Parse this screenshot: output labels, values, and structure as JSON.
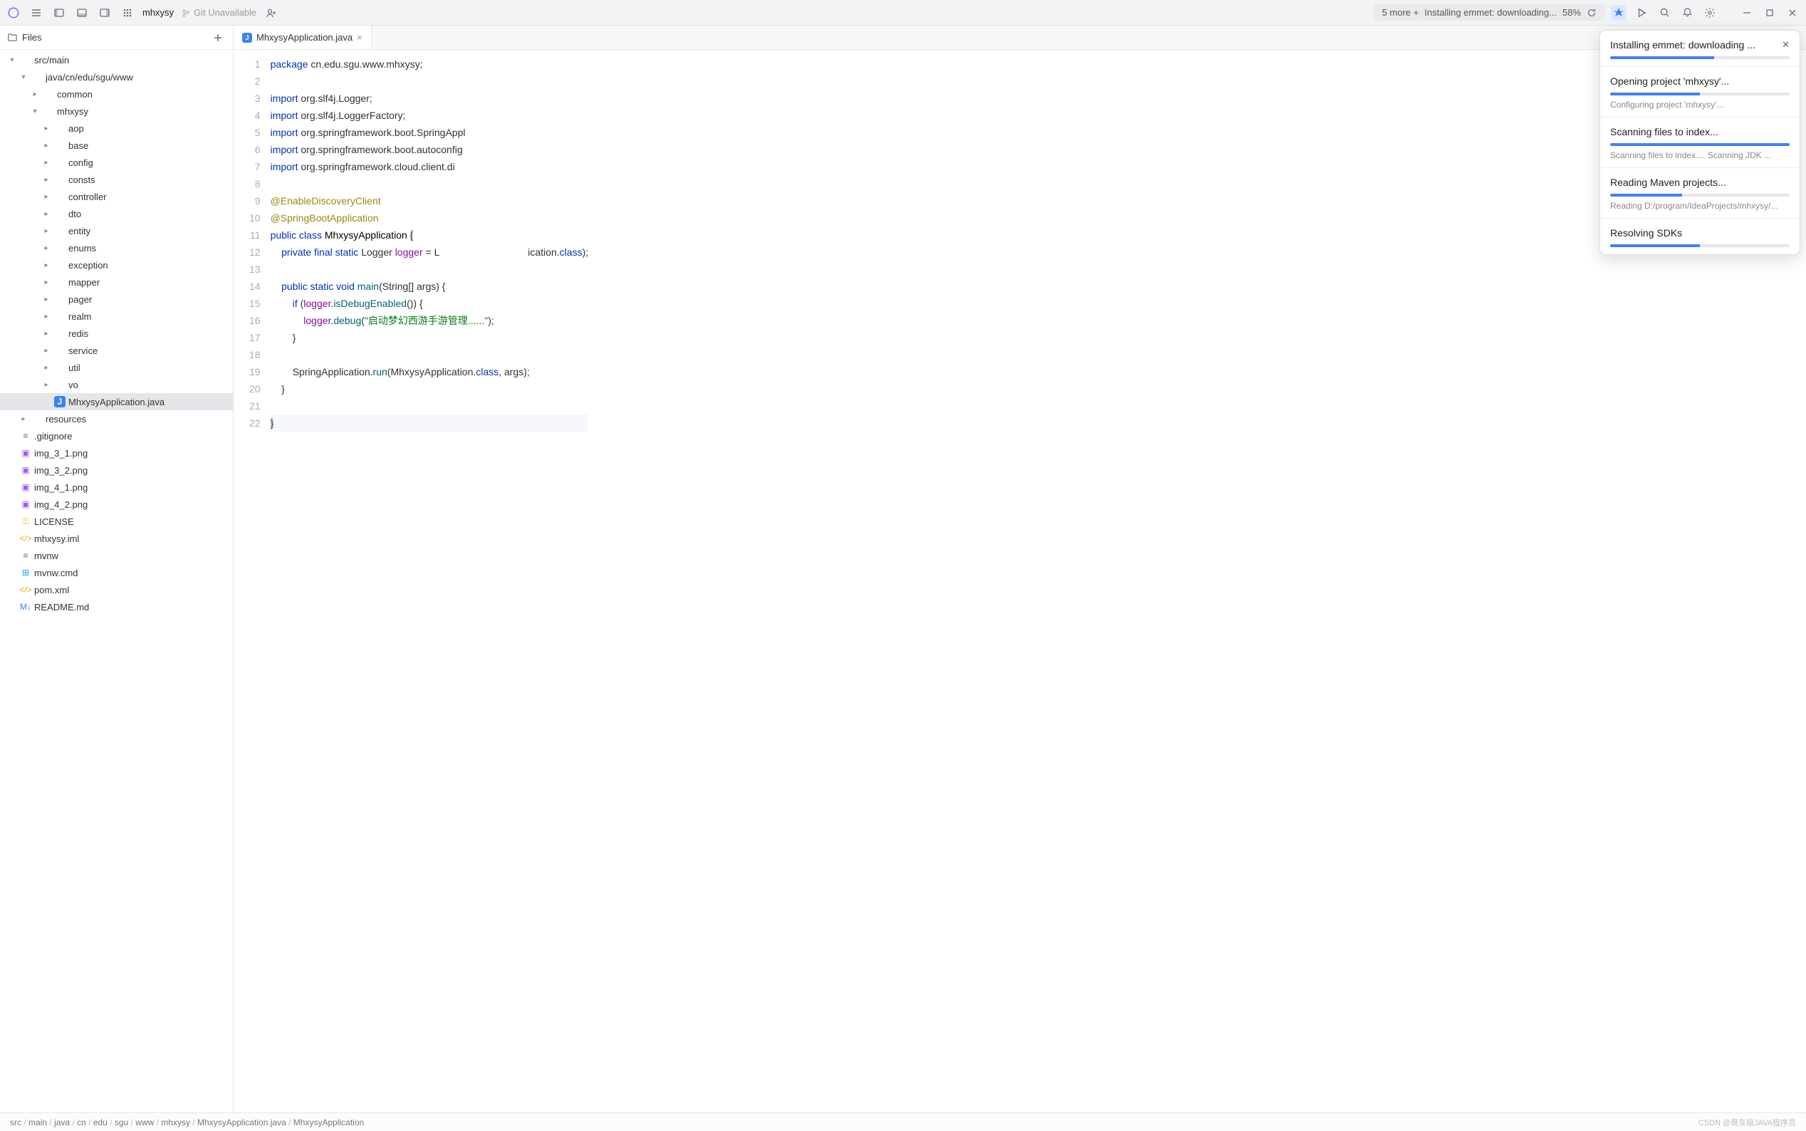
{
  "titlebar": {
    "project_name": "mhxysy",
    "git_status": "Git Unavailable",
    "bg_status_prefix": "5 more +",
    "bg_status_text": "Installing emmet: downloading...",
    "bg_status_pct": "58%"
  },
  "sidebar": {
    "title": "Files"
  },
  "tree": [
    {
      "depth": 0,
      "expand": "down",
      "icon": "folder",
      "label": "src/main"
    },
    {
      "depth": 1,
      "expand": "down",
      "icon": "folder",
      "label": "java/cn/edu/sgu/www"
    },
    {
      "depth": 2,
      "expand": "right",
      "icon": "folder",
      "label": "common"
    },
    {
      "depth": 2,
      "expand": "down",
      "icon": "folder",
      "label": "mhxysy"
    },
    {
      "depth": 3,
      "expand": "right",
      "icon": "folder",
      "label": "aop"
    },
    {
      "depth": 3,
      "expand": "right",
      "icon": "folder",
      "label": "base"
    },
    {
      "depth": 3,
      "expand": "right",
      "icon": "folder",
      "label": "config"
    },
    {
      "depth": 3,
      "expand": "right",
      "icon": "folder",
      "label": "consts"
    },
    {
      "depth": 3,
      "expand": "right",
      "icon": "folder",
      "label": "controller"
    },
    {
      "depth": 3,
      "expand": "right",
      "icon": "folder",
      "label": "dto"
    },
    {
      "depth": 3,
      "expand": "right",
      "icon": "folder",
      "label": "entity"
    },
    {
      "depth": 3,
      "expand": "right",
      "icon": "folder",
      "label": "enums"
    },
    {
      "depth": 3,
      "expand": "right",
      "icon": "folder",
      "label": "exception"
    },
    {
      "depth": 3,
      "expand": "right",
      "icon": "folder",
      "label": "mapper"
    },
    {
      "depth": 3,
      "expand": "right",
      "icon": "folder",
      "label": "pager"
    },
    {
      "depth": 3,
      "expand": "right",
      "icon": "folder",
      "label": "realm"
    },
    {
      "depth": 3,
      "expand": "right",
      "icon": "folder",
      "label": "redis"
    },
    {
      "depth": 3,
      "expand": "right",
      "icon": "folder",
      "label": "service"
    },
    {
      "depth": 3,
      "expand": "right",
      "icon": "folder",
      "label": "util"
    },
    {
      "depth": 3,
      "expand": "right",
      "icon": "folder",
      "label": "vo"
    },
    {
      "depth": 3,
      "expand": "none",
      "icon": "java",
      "label": "MhxysyApplication.java",
      "selected": true
    },
    {
      "depth": 1,
      "expand": "right",
      "icon": "folder",
      "label": "resources"
    },
    {
      "depth": 0,
      "expand": "none",
      "icon": "txt",
      "label": ".gitignore"
    },
    {
      "depth": 0,
      "expand": "none",
      "icon": "img",
      "label": "img_3_1.png"
    },
    {
      "depth": 0,
      "expand": "none",
      "icon": "img",
      "label": "img_3_2.png"
    },
    {
      "depth": 0,
      "expand": "none",
      "icon": "img",
      "label": "img_4_1.png"
    },
    {
      "depth": 0,
      "expand": "none",
      "icon": "img",
      "label": "img_4_2.png"
    },
    {
      "depth": 0,
      "expand": "none",
      "icon": "key",
      "label": "LICENSE"
    },
    {
      "depth": 0,
      "expand": "none",
      "icon": "xml",
      "label": "mhxysy.iml"
    },
    {
      "depth": 0,
      "expand": "none",
      "icon": "txt",
      "label": "mvnw"
    },
    {
      "depth": 0,
      "expand": "none",
      "icon": "win",
      "label": "mvnw.cmd"
    },
    {
      "depth": 0,
      "expand": "none",
      "icon": "xml",
      "label": "pom.xml"
    },
    {
      "depth": 0,
      "expand": "none",
      "icon": "md",
      "label": "README.md"
    }
  ],
  "tab": {
    "icon": "java",
    "label": "MhxysyApplication.java"
  },
  "code_lines": [
    {
      "n": 1,
      "t": [
        [
          "kw",
          "package"
        ],
        [
          "",
          " cn.edu.sgu.www.mhxysy;"
        ]
      ]
    },
    {
      "n": 2,
      "t": [
        [
          "",
          ""
        ]
      ]
    },
    {
      "n": 3,
      "t": [
        [
          "kw",
          "import"
        ],
        [
          "",
          " org.slf4j.Logger;"
        ]
      ]
    },
    {
      "n": 4,
      "t": [
        [
          "kw",
          "import"
        ],
        [
          "",
          " org.slf4j.LoggerFactory;"
        ]
      ]
    },
    {
      "n": 5,
      "t": [
        [
          "kw",
          "import"
        ],
        [
          "",
          " org.springframework.boot.SpringAppl"
        ]
      ]
    },
    {
      "n": 6,
      "t": [
        [
          "kw",
          "import"
        ],
        [
          "",
          " org.springframework.boot.autoconfig"
        ]
      ]
    },
    {
      "n": 7,
      "t": [
        [
          "kw",
          "import"
        ],
        [
          "",
          " org.springframework.cloud.client.di"
        ]
      ]
    },
    {
      "n": 8,
      "t": [
        [
          "",
          ""
        ]
      ]
    },
    {
      "n": 9,
      "t": [
        [
          "ann",
          "@EnableDiscoveryClient"
        ]
      ]
    },
    {
      "n": 10,
      "t": [
        [
          "ann",
          "@SpringBootApplication"
        ]
      ]
    },
    {
      "n": 11,
      "t": [
        [
          "kw",
          "public class"
        ],
        [
          "",
          " "
        ],
        [
          "cls",
          "MhxysyApplication"
        ],
        [
          "",
          " "
        ],
        [
          "hl-brace",
          "{"
        ]
      ]
    },
    {
      "n": 12,
      "t": [
        [
          "",
          "    "
        ],
        [
          "kw",
          "private final static"
        ],
        [
          "",
          " Logger "
        ],
        [
          "id",
          "logger"
        ],
        [
          "",
          " = L                                ication."
        ],
        [
          "kw",
          "class"
        ],
        [
          "",
          ");"
        ]
      ]
    },
    {
      "n": 13,
      "t": [
        [
          "",
          ""
        ]
      ]
    },
    {
      "n": 14,
      "t": [
        [
          "",
          "    "
        ],
        [
          "kw",
          "public static void"
        ],
        [
          "",
          " "
        ],
        [
          "mtd",
          "main"
        ],
        [
          "",
          "(String[] args) {"
        ]
      ]
    },
    {
      "n": 15,
      "t": [
        [
          "",
          "        "
        ],
        [
          "kw",
          "if"
        ],
        [
          "",
          " ("
        ],
        [
          "id",
          "logger"
        ],
        [
          "",
          "."
        ],
        [
          "mtd",
          "isDebugEnabled"
        ],
        [
          "",
          "()) {"
        ]
      ]
    },
    {
      "n": 16,
      "t": [
        [
          "",
          "            "
        ],
        [
          "id",
          "logger"
        ],
        [
          "",
          "."
        ],
        [
          "mtd",
          "debug"
        ],
        [
          "",
          "("
        ],
        [
          "str",
          "\"启动梦幻西游手游管理......\""
        ],
        [
          "",
          ");"
        ]
      ]
    },
    {
      "n": 17,
      "t": [
        [
          "",
          "        }"
        ]
      ]
    },
    {
      "n": 18,
      "t": [
        [
          "",
          ""
        ]
      ]
    },
    {
      "n": 19,
      "t": [
        [
          "",
          "        SpringApplication."
        ],
        [
          "mtd",
          "run"
        ],
        [
          "",
          "(MhxysyApplication."
        ],
        [
          "kw",
          "class"
        ],
        [
          "",
          ", args);"
        ]
      ]
    },
    {
      "n": 20,
      "t": [
        [
          "",
          "    }"
        ]
      ]
    },
    {
      "n": 21,
      "t": [
        [
          "",
          ""
        ]
      ]
    },
    {
      "n": 22,
      "t": [
        [
          "hl-brace",
          "}"
        ]
      ],
      "hl": true
    }
  ],
  "popup": [
    {
      "title": "Installing emmet: downloading ...",
      "pct": 58,
      "closable": true
    },
    {
      "title": "Opening project 'mhxysy'...",
      "indet": true,
      "sub": "Configuring project 'mhxysy'..."
    },
    {
      "title": "Scanning files to index...",
      "pct": 100,
      "sub": "Scanning files to index.... Scanning JDK ..."
    },
    {
      "title": "Reading Maven projects...",
      "pct": 40,
      "sub": "Reading D:/program/IdeaProjects/mhxysy/..."
    },
    {
      "title": "Resolving SDKs",
      "indet": true
    }
  ],
  "breadcrumbs": [
    "src",
    "main",
    "java",
    "cn",
    "edu",
    "sgu",
    "www",
    "mhxysy",
    "MhxysyApplication.java",
    "MhxysyApplication"
  ],
  "watermark": "CSDN @骨灰级JAVA程序员"
}
